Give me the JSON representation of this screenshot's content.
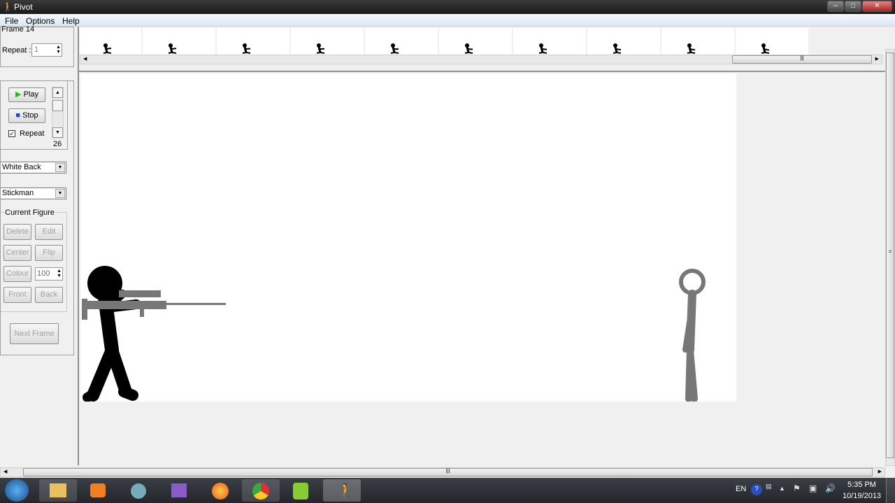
{
  "window": {
    "title": "Pivot",
    "controls": [
      "minimize",
      "maximize",
      "close"
    ]
  },
  "menu": [
    "File",
    "Options",
    "Help"
  ],
  "frame_panel": {
    "frame_label": "Frame 14",
    "repeat_label": "Repeat :",
    "repeat_value": "1"
  },
  "playback": {
    "play_label": "Play",
    "stop_label": "Stop",
    "repeat_label": "Repeat",
    "repeat_checked": true,
    "speed_value": "26"
  },
  "background_select": {
    "value": "White Back"
  },
  "figure_type_select": {
    "value": "Stickman"
  },
  "current_figure": {
    "legend": "Current Figure",
    "delete": "Delete",
    "edit": "Edit",
    "center": "Center",
    "flip": "Flip",
    "colour": "Colour",
    "size_value": "100",
    "front": "Front",
    "back": "Back"
  },
  "next_frame_label": "Next Frame",
  "timeline": {
    "frame_count_visible": 10
  },
  "tray": {
    "language": "EN",
    "time": "5:35 PM",
    "date": "10/19/2013"
  },
  "taskbar_apps": [
    "windows-start",
    "file-explorer",
    "media-player",
    "chrome-alt",
    "visual-studio",
    "firefox",
    "chrome",
    "notepad-plus",
    "pivot"
  ]
}
